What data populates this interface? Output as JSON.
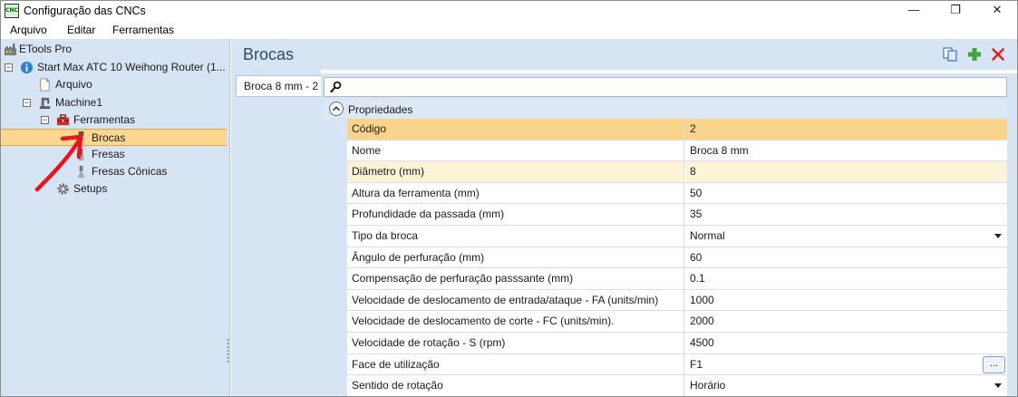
{
  "window": {
    "app_icon_text": "CNC",
    "title": "Configuração das CNCs",
    "minimize": "—",
    "maximize": "❐",
    "close": "✕"
  },
  "menu": [
    "Arquivo",
    "Editar",
    "Ferramentas"
  ],
  "tree": {
    "root": "ETools Pro",
    "machine_entry": "Start Max ATC 10 Weihong Router (1...",
    "arquivo": "Arquivo",
    "machine": "Machine1",
    "ferramentas": "Ferramentas",
    "brocas": "Brocas",
    "fresas": "Fresas",
    "fresas_conicas": "Fresas Cônicas",
    "setups": "Setups"
  },
  "header": {
    "title": "Brocas",
    "copy_icon": "copy-icon",
    "add_icon": "add-icon",
    "delete_icon": "delete-icon"
  },
  "tab": {
    "label": "Broca 8 mm - 2"
  },
  "search": {
    "value": "",
    "placeholder": ""
  },
  "category": {
    "label": "Propriedades"
  },
  "properties": [
    {
      "name": "Código",
      "value": "2"
    },
    {
      "name": "Nome",
      "value": "Broca 8 mm"
    },
    {
      "name": "Diâmetro (mm)",
      "value": "8"
    },
    {
      "name": "Altura da ferramenta (mm)",
      "value": "50"
    },
    {
      "name": "Profundidade da passada (mm)",
      "value": "35"
    },
    {
      "name": "Tipo da broca",
      "value": "Normal"
    },
    {
      "name": "Ângulo de perfuração (mm)",
      "value": "60"
    },
    {
      "name": "Compensação de perfuração passsante (mm)",
      "value": "0.1"
    },
    {
      "name": "Velocidade de deslocamento de entrada/ataque - FA (units/min)",
      "value": "1000"
    },
    {
      "name": "Velocidade de deslocamento de corte - FC (units/min).",
      "value": "2000"
    },
    {
      "name": "Velocidade de rotação - S (rpm)",
      "value": "4500"
    },
    {
      "name": "Face de utilização",
      "value": "F1"
    },
    {
      "name": "Sentido de rotação",
      "value": "Horário"
    }
  ],
  "ellipsis_label": "...",
  "colors": {
    "panel_bg": "#d6e4f3",
    "selection": "#fbd48c",
    "title_blue": "#2b4c72",
    "annotation_red": "#e8141e"
  }
}
